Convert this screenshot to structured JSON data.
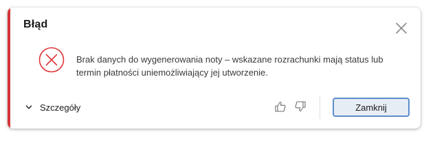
{
  "dialog": {
    "title": "Błąd",
    "message": "Brak danych do wygenerowania noty – wskazane rozrachunki mają status lub termin płatności uniemożliwiający jej utworzenie.",
    "details_label": "Szczegóły",
    "close_button_label": "Zamknij",
    "icons": {
      "close": "close-icon",
      "error": "error-circle-x-icon",
      "details": "chevron-down-icon",
      "feedback_positive": "thumbs-up-icon",
      "feedback_negative": "thumbs-down-icon"
    },
    "colors": {
      "accent": "#d13438",
      "error_icon": "#e0363a",
      "button_border": "#5b8ccc",
      "button_background": "#e7edf5"
    }
  }
}
